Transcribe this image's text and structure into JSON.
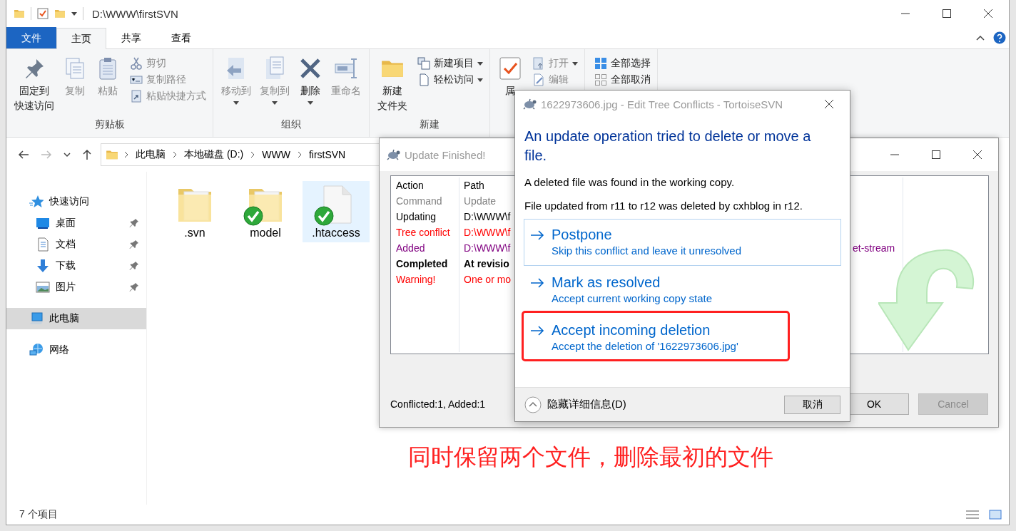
{
  "explorer": {
    "title": "D:\\WWW\\firstSVN",
    "ribbon_tabs": [
      {
        "label": "文件",
        "kind": "menu",
        "selected": false
      },
      {
        "label": "主页",
        "kind": "tab",
        "selected": true
      },
      {
        "label": "共享",
        "kind": "tab",
        "selected": false
      },
      {
        "label": "查看",
        "kind": "tab",
        "selected": false
      }
    ],
    "ribbon_groups": [
      {
        "label": "剪贴板",
        "large_buttons": [
          {
            "label": [
              "固定到",
              "快速访问"
            ],
            "disabled": false,
            "dropdown": false
          },
          {
            "label": "复制",
            "disabled": true,
            "dropdown": false
          },
          {
            "label": "粘贴",
            "disabled": true,
            "dropdown": false
          }
        ],
        "small_buttons": [
          {
            "label": "剪切",
            "disabled": true,
            "dropdown": false
          },
          {
            "label": "复制路径",
            "disabled": true,
            "dropdown": false
          },
          {
            "label": "粘贴快捷方式",
            "disabled": true,
            "dropdown": false
          }
        ]
      },
      {
        "label": "组织",
        "large_buttons": [
          {
            "label": "移动到",
            "disabled": true,
            "dropdown": true
          },
          {
            "label": "复制到",
            "disabled": true,
            "dropdown": true
          },
          {
            "label": "删除",
            "disabled": false,
            "dropdown": true
          },
          {
            "label": "重命名",
            "disabled": true,
            "dropdown": false
          }
        ]
      },
      {
        "label": "新建",
        "large_buttons": [
          {
            "label": [
              "新建",
              "文件夹"
            ],
            "disabled": false,
            "dropdown": false
          }
        ],
        "small_buttons": [
          {
            "label": "新建项目",
            "disabled": false,
            "dropdown": true
          },
          {
            "label": "轻松访问",
            "disabled": false,
            "dropdown": true
          }
        ]
      },
      {
        "large_buttons": [
          {
            "label": "属",
            "disabled": false,
            "dropdown": false
          }
        ],
        "small_buttons": [
          {
            "label": "打开",
            "disabled": true,
            "dropdown": true
          },
          {
            "label": "编辑",
            "disabled": true,
            "dropdown": false
          }
        ]
      },
      {
        "small_buttons": [
          {
            "label": "全部选择",
            "disabled": false,
            "dropdown": false
          },
          {
            "label": "全部取消",
            "disabled": false,
            "dropdown": false
          }
        ]
      }
    ],
    "breadcrumb": [
      "此电脑",
      "本地磁盘 (D:)",
      "WWW",
      "firstSVN"
    ],
    "nav": [
      {
        "label": "快速访问",
        "selected": false,
        "pinned": false,
        "children": [
          {
            "label": "桌面",
            "selected": false,
            "pinned": true
          },
          {
            "label": "文档",
            "selected": false,
            "pinned": true
          },
          {
            "label": "下载",
            "selected": false,
            "pinned": true
          },
          {
            "label": "图片",
            "selected": false,
            "pinned": true
          }
        ]
      },
      {
        "label": "此电脑",
        "selected": true,
        "pinned": false
      },
      {
        "label": "网络",
        "selected": false,
        "pinned": false
      }
    ],
    "files": [
      {
        "name": ".svn",
        "kind": "folder",
        "versioned": false,
        "selected": false
      },
      {
        "name": "model",
        "kind": "folder",
        "versioned": true,
        "selected": false
      },
      {
        "name": ".htaccess",
        "kind": "file",
        "versioned": true,
        "selected": true
      }
    ],
    "status_bar": {
      "item_count": "7 个项目"
    }
  },
  "update_dialog": {
    "title": "Update Finished!",
    "columns": [
      "Action",
      "Path"
    ],
    "rows": [
      {
        "cells": [
          "Command",
          "Update"
        ],
        "color": "#808080",
        "bold": false
      },
      {
        "cells": [
          "Updating",
          "D:\\WWW\\f"
        ],
        "color": "#000000",
        "bold": false
      },
      {
        "cells": [
          "Tree conflict",
          "D:\\WWW\\f"
        ],
        "color": "#ff0000",
        "bold": false
      },
      {
        "cells": [
          "Added",
          "D:\\WWW\\f",
          "et-stream"
        ],
        "color": "#800080",
        "bold": false
      },
      {
        "cells": [
          "Completed",
          "At revisio"
        ],
        "color": "#000000",
        "bold": true
      },
      {
        "cells": [
          "Warning!",
          "One or mo"
        ],
        "color": "#ff0000",
        "bold": false
      }
    ],
    "summary": "Conflicted:1, Added:1",
    "buttons": [
      {
        "label": "OK",
        "disabled": false
      },
      {
        "label": "Cancel",
        "disabled": true
      }
    ]
  },
  "conflict_dialog": {
    "title": "1622973606.jpg - Edit Tree Conflicts - TortoiseSVN",
    "heading": "An update operation tried to delete or move a file.",
    "messages": [
      "A deleted file was found in the working copy.",
      "File updated from r11 to r12 was deleted by cxhblog in r12."
    ],
    "options": [
      {
        "title": "Postpone",
        "subtitle": "Skip this conflict and leave it unresolved",
        "selected": true,
        "annotated": false
      },
      {
        "title": "Mark as resolved",
        "subtitle": "Accept current working copy state",
        "selected": false,
        "annotated": false
      },
      {
        "title": "Accept incoming deletion",
        "subtitle": "Accept the deletion of '1622973606.jpg'",
        "selected": false,
        "annotated": true
      }
    ],
    "details_toggle": "隐藏详细信息(D)",
    "buttons": [
      {
        "label": "取消"
      }
    ]
  },
  "annotation": {
    "caption": "同时保留两个文件，删除最初的文件"
  }
}
